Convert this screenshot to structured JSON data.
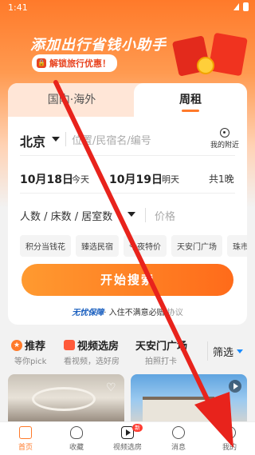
{
  "status": {
    "time": "1:41"
  },
  "banner": {
    "title": "添加出行省钱小助手",
    "subtitle": "解锁旅行优惠！"
  },
  "tabs": {
    "domestic": "国内·海外",
    "weekly": "周租"
  },
  "search": {
    "city": "北京",
    "placeholder": "位置/民宿名/编号",
    "nearby": "我的附近"
  },
  "dates": {
    "checkin": "10月18日",
    "checkin_day": "今天",
    "checkout": "10月19日",
    "checkout_day": "明天",
    "nights": "共1晚"
  },
  "guests": {
    "label": "人数 / 床数 / 居室数",
    "price_placeholder": "价格"
  },
  "chips": [
    "积分当钱花",
    "臻选民宿",
    "今夜特价",
    "天安门广场",
    "珠市"
  ],
  "start_button": "开始搜索",
  "guarantee": {
    "brand": "无忧保障",
    "text": "· 入住不满意必赔",
    "agree": "协议"
  },
  "feed_tabs": [
    {
      "title": "推荐",
      "sub": "等你pick"
    },
    {
      "title": "视频选房",
      "sub": "看视频，选好房"
    },
    {
      "title": "天安门广场",
      "sub": "拍照打卡"
    }
  ],
  "filter": "筛选",
  "nav": {
    "home": "首页",
    "favorites": "收藏",
    "video": "视频选房",
    "video_badge": "新",
    "messages": "消息",
    "me": "我的"
  },
  "colors": {
    "accent": "#ff7a2a",
    "arrow": "#e8231c"
  }
}
